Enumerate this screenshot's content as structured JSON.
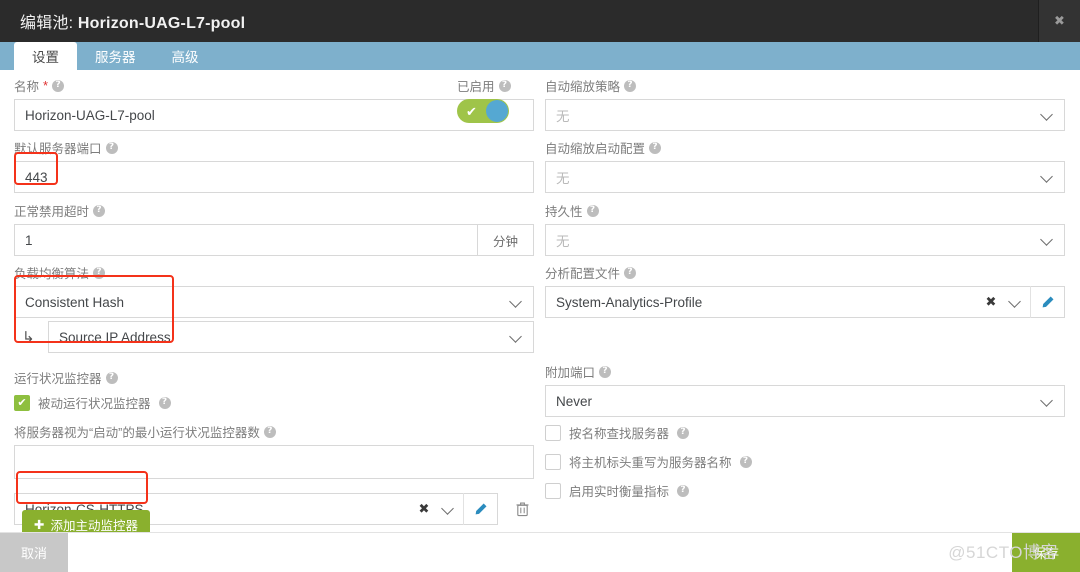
{
  "window": {
    "title_prefix": "编辑池: ",
    "title_value": "Horizon-UAG-L7-pool",
    "close_icon": "✖"
  },
  "tabs": [
    {
      "label": "设置",
      "active": true
    },
    {
      "label": "服务器",
      "active": false
    },
    {
      "label": "高级",
      "active": false
    }
  ],
  "left": {
    "name": {
      "label": "名称",
      "required_mark": "*",
      "value": "Horizon-UAG-L7-pool"
    },
    "default_server_port": {
      "label": "默认服务器端口",
      "value": "443",
      "highlighted": true
    },
    "graceful_disable_timeout": {
      "label": "正常禁用超时",
      "value": "1",
      "unit": "分钟"
    },
    "lb_algorithm": {
      "label": "负载均衡算法",
      "value": "Consistent Hash",
      "nested_arrow": "↳",
      "nested_value": "Source IP Address",
      "highlighted": true
    },
    "health_monitors": {
      "label": "运行状况监控器",
      "passive_checkbox": {
        "label": "被动运行状况监控器",
        "checked": true
      },
      "min_monitors_label": "将服务器视为“启动”的最小运行状况监控器数",
      "min_monitors_value": "",
      "monitor_row": {
        "value": "Horizon-CS-HTTPS",
        "clear_icon": "✖",
        "highlighted": true
      },
      "add_button": "添加主动监控器",
      "add_button_icon": "✚"
    }
  },
  "right": {
    "autoscale_policy": {
      "label": "自动缩放策略",
      "value": "无"
    },
    "autoscale_launch_config": {
      "label": "自动缩放启动配置",
      "value": "无"
    },
    "persistence": {
      "label": "持久性",
      "value": "无"
    },
    "analytics_profile": {
      "label": "分析配置文件",
      "value": "System-Analytics-Profile",
      "clear_icon": "✖"
    },
    "attached_port": {
      "label": "附加端口",
      "value": "Never"
    },
    "checkboxes": [
      {
        "label": "按名称查找服务器",
        "checked": false
      },
      {
        "label": "将主机标头重写为服务器名称",
        "checked": false
      },
      {
        "label": "启用实时衡量指标",
        "checked": false
      }
    ]
  },
  "footer": {
    "cancel_label": "取消",
    "save_label": "保存"
  },
  "watermark": "@51CTO博客",
  "colors": {
    "titlebar": "#2b2b2b",
    "tabbar": "#7eb0cc",
    "accent_green": "#8ab02e",
    "toggle_knob": "#55a8d2",
    "annotation_red": "#f4321a"
  },
  "help_icon": "?"
}
